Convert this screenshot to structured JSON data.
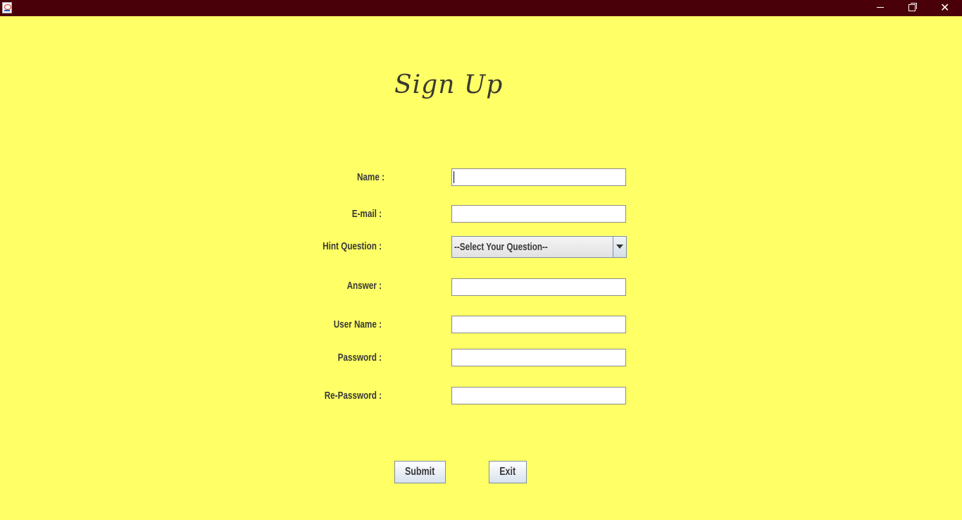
{
  "window": {
    "controls": {
      "minimize": "—",
      "maximize": "❐",
      "close": "✕"
    }
  },
  "form": {
    "title": "Sign Up",
    "fields": {
      "name": {
        "label": "Name :",
        "value": ""
      },
      "email": {
        "label": "E-mail :",
        "value": ""
      },
      "hint_question": {
        "label": "Hint Question :",
        "selected": "--Select Your Question--"
      },
      "answer": {
        "label": "Answer :",
        "value": ""
      },
      "username": {
        "label": "User Name :",
        "value": ""
      },
      "password": {
        "label": "Password :",
        "value": ""
      },
      "repassword": {
        "label": "Re-Password :",
        "value": ""
      }
    },
    "buttons": {
      "submit": "Submit",
      "exit": "Exit"
    }
  },
  "colors": {
    "background": "#ffff66",
    "titlebar": "#4a0008"
  }
}
